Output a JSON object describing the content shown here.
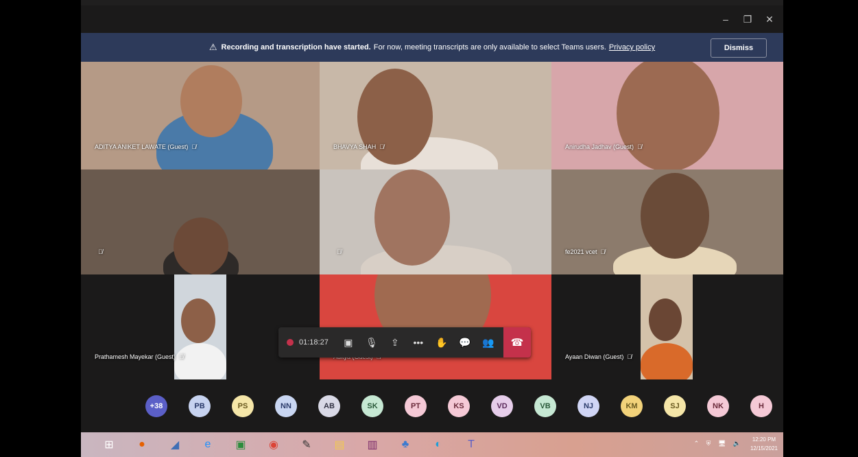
{
  "window": {
    "controls": [
      "–",
      "❐",
      "✕"
    ]
  },
  "banner": {
    "bold_text": "Recording and transcription have started.",
    "text": "For now, meeting transcripts are only available to select Teams users.",
    "link": "Privacy policy",
    "dismiss_label": "Dismiss",
    "warning_icon": "⚠"
  },
  "participants": [
    {
      "name": "ADITYA ANIKET LAWATE (Guest)",
      "bg": "#b59a86",
      "skin": "#b07d5e"
    },
    {
      "name": "BHAVYA SHAH",
      "bg": "#c8b8a8",
      "skin": "#8c6048"
    },
    {
      "name": "Anirudha Jadhav (Guest)",
      "bg": "#d7a6aa",
      "skin": "#9c6a52"
    },
    {
      "name": "",
      "bg": "#6a5a4e",
      "skin": "#6c4a38"
    },
    {
      "name": "",
      "bg": "#c9c3bd",
      "skin": "#a07460"
    },
    {
      "name": "fe2021 vcet",
      "bg": "#8c7b6c",
      "skin": "#6a4b38"
    },
    {
      "name": "Prathamesh Mayekar (Guest)",
      "bg": "#d0d6dc",
      "skin": "#8d6048"
    },
    {
      "name": "Aditya (Guest)",
      "bg": "#d9463f",
      "skin": "#a06a50"
    },
    {
      "name": "Ayaan Diwan (Guest)",
      "bg": "#d4c2aa",
      "skin": "#6a4634"
    }
  ],
  "controls": {
    "timer": "01:18:27",
    "icons": [
      "camera-off-icon",
      "mic-off-icon",
      "share-icon",
      "more-icon",
      "raise-hand-icon",
      "chat-icon",
      "people-icon"
    ],
    "glyphs": [
      "▣",
      "🎙",
      "⇪",
      "•••",
      "✋",
      "💬",
      "👥"
    ],
    "leave_glyph": "☎"
  },
  "roster": [
    {
      "label": "+38",
      "bg": "#5b5fc7",
      "fg": "#ffffff"
    },
    {
      "label": "PB",
      "bg": "#c7d3f0",
      "fg": "#2a3a6a"
    },
    {
      "label": "PS",
      "bg": "#f5e6a8",
      "fg": "#6a5a20"
    },
    {
      "label": "NN",
      "bg": "#c9d6f2",
      "fg": "#2a3a6a"
    },
    {
      "label": "AB",
      "bg": "#d9d9e6",
      "fg": "#333344"
    },
    {
      "label": "SK",
      "bg": "#c6e8d3",
      "fg": "#2a5a3a"
    },
    {
      "label": "PT",
      "bg": "#f5c9d6",
      "fg": "#6a2a3a"
    },
    {
      "label": "KS",
      "bg": "#f5c9d6",
      "fg": "#6a2a3a"
    },
    {
      "label": "VD",
      "bg": "#e6cdea",
      "fg": "#5a2a5a"
    },
    {
      "label": "VB",
      "bg": "#c6e8d3",
      "fg": "#2a5a3a"
    },
    {
      "label": "NJ",
      "bg": "#d0d5f5",
      "fg": "#2a3a6a"
    },
    {
      "label": "KM",
      "bg": "#f2d27a",
      "fg": "#6a5a20"
    },
    {
      "label": "SJ",
      "bg": "#f5e6a8",
      "fg": "#6a5a20"
    },
    {
      "label": "NK",
      "bg": "#f5c9d6",
      "fg": "#6a2a3a"
    },
    {
      "label": "H",
      "bg": "#f5c9d6",
      "fg": "#6a2a3a"
    }
  ],
  "taskbar": {
    "apps": [
      {
        "name": "start-icon",
        "glyph": "⊞",
        "color": "#ffffff"
      },
      {
        "name": "firefox-icon",
        "glyph": "●",
        "color": "#e66000"
      },
      {
        "name": "notes-icon",
        "glyph": "◢",
        "color": "#3f6fb5"
      },
      {
        "name": "ie-icon",
        "glyph": "e",
        "color": "#1e90ff"
      },
      {
        "name": "store-icon",
        "glyph": "▣",
        "color": "#2c8c3c"
      },
      {
        "name": "chrome-icon",
        "glyph": "◉",
        "color": "#db4437"
      },
      {
        "name": "tool-icon",
        "glyph": "✎",
        "color": "#333333"
      },
      {
        "name": "folder-icon",
        "glyph": "▤",
        "color": "#f2c94c"
      },
      {
        "name": "archive-icon",
        "glyph": "▥",
        "color": "#7a2a6a"
      },
      {
        "name": "people-app-icon",
        "glyph": "♣",
        "color": "#3a7ad0"
      },
      {
        "name": "edge-icon",
        "glyph": "◐",
        "color": "#1e9fd8"
      },
      {
        "name": "teams-icon",
        "glyph": "T",
        "color": "#5b5fc7"
      }
    ],
    "tray": "⌃ ⛨ 🖥 🔈",
    "time": "12:20 PM",
    "date": "12/15/2021"
  }
}
